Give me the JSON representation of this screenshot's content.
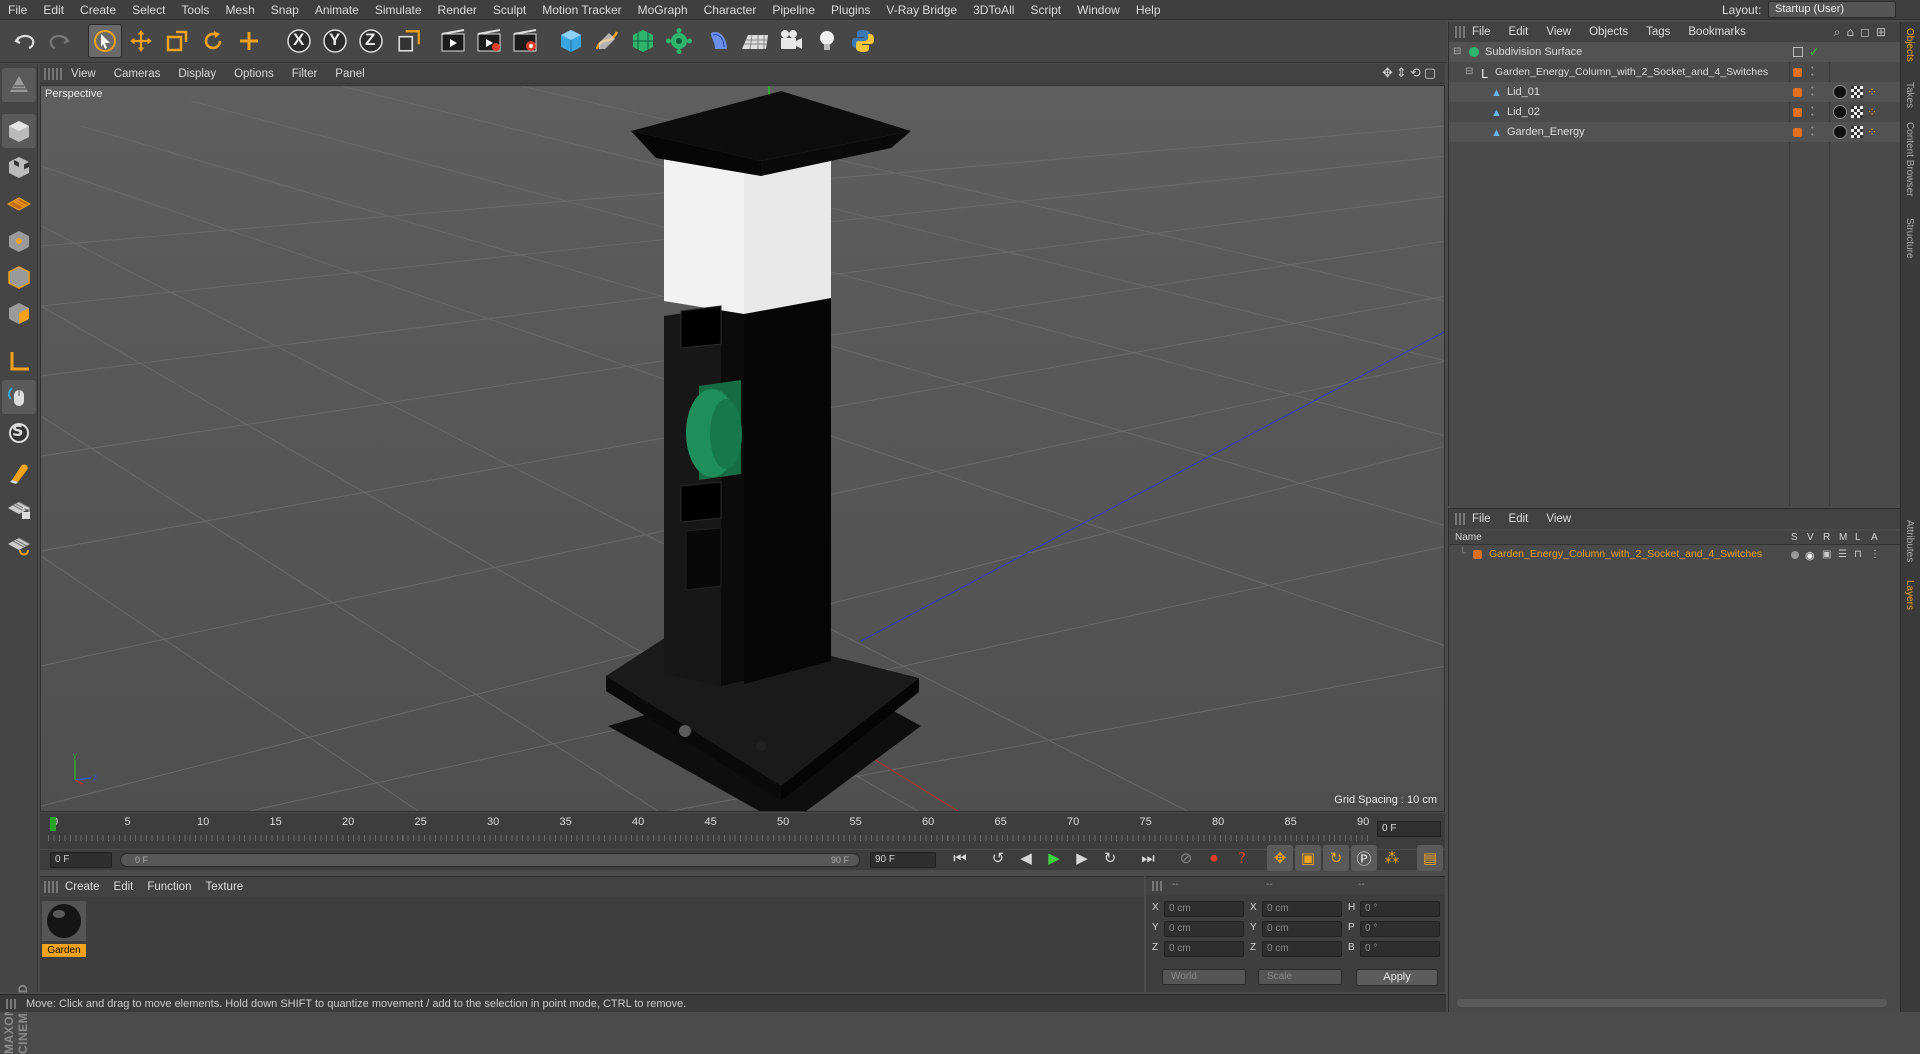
{
  "menubar": {
    "items": [
      "File",
      "Edit",
      "Create",
      "Select",
      "Tools",
      "Mesh",
      "Snap",
      "Animate",
      "Simulate",
      "Render",
      "Sculpt",
      "Motion Tracker",
      "MoGraph",
      "Character",
      "Pipeline",
      "Plugins",
      "V-Ray Bridge",
      "3DToAll",
      "Script",
      "Window",
      "Help"
    ],
    "layout_label": "Layout:",
    "layout_value": "Startup (User)"
  },
  "toolbar": {
    "icons": [
      "undo-icon",
      "redo-icon",
      "live-selection-icon",
      "move-icon",
      "scale-icon",
      "rotate-icon",
      "move-last-icon",
      "x-axis-icon",
      "y-axis-icon",
      "z-axis-icon",
      "coordinate-system-icon",
      "render-view-icon",
      "render-picture-viewer-icon",
      "edit-render-settings-icon",
      "cube-icon",
      "pen-spline-icon",
      "subdivision-icon",
      "cloner-icon",
      "deformer-icon",
      "floor-icon",
      "camera-icon",
      "light-icon",
      "python-icon"
    ],
    "axis_labels": [
      "X",
      "Y",
      "Z"
    ]
  },
  "viewport": {
    "menu": [
      "View",
      "Cameras",
      "Display",
      "Options",
      "Filter",
      "Panel"
    ],
    "label": "Perspective",
    "grid_spacing": "Grid Spacing : 10 cm"
  },
  "timeline": {
    "ticks": [
      "0",
      "5",
      "10",
      "15",
      "20",
      "25",
      "30",
      "35",
      "40",
      "45",
      "50",
      "55",
      "60",
      "65",
      "70",
      "75",
      "80",
      "85",
      "90"
    ],
    "current_frame": "0 F"
  },
  "transport": {
    "start_field": "0 F",
    "range_start": "0 F",
    "range_end": "90 F",
    "end_field": "90 F"
  },
  "material_panel": {
    "menu": [
      "Create",
      "Edit",
      "Function",
      "Texture"
    ],
    "material_name": "Garden"
  },
  "coords": {
    "header": [
      "--",
      "--",
      "--"
    ],
    "rows": [
      {
        "a": "X",
        "av": "0 cm",
        "b": "X",
        "bv": "0 cm",
        "c": "H",
        "cv": "0 °"
      },
      {
        "a": "Y",
        "av": "0 cm",
        "b": "Y",
        "bv": "0 cm",
        "c": "P",
        "cv": "0 °"
      },
      {
        "a": "Z",
        "av": "0 cm",
        "b": "Z",
        "bv": "0 cm",
        "c": "B",
        "cv": "0 °"
      }
    ],
    "world": "World",
    "scale": "Scale",
    "apply": "Apply"
  },
  "status": {
    "text": "Move: Click and drag to move elements. Hold down SHIFT to quantize movement / add to the selection in point mode, CTRL to remove."
  },
  "objects": {
    "menu": [
      "File",
      "Edit",
      "View",
      "Objects",
      "Tags",
      "Bookmarks"
    ],
    "tree": [
      {
        "name": "Subdivision Surface",
        "indent": 0
      },
      {
        "name": "Garden_Energy_Column_with_2_Socket_and_4_Switches",
        "indent": 1
      },
      {
        "name": "Lid_01",
        "indent": 2
      },
      {
        "name": "Lid_02",
        "indent": 2
      },
      {
        "name": "Garden_Energy",
        "indent": 2
      }
    ]
  },
  "layers": {
    "menu": [
      "File",
      "Edit",
      "View"
    ],
    "header_name": "Name",
    "header_cols": [
      "S",
      "V",
      "R",
      "M",
      "L",
      "A"
    ],
    "row": "Garden_Energy_Column_with_2_Socket_and_4_Switches"
  },
  "side_tabs": [
    "Objects",
    "Takes",
    "Content Browser",
    "Structure",
    "Attributes",
    "Layers"
  ],
  "branding": "MAXON CINEMA 4D",
  "colors": {
    "accent": "#f2a21b",
    "layer_text": "#f2a21b",
    "socket": "#1e8f5c"
  }
}
